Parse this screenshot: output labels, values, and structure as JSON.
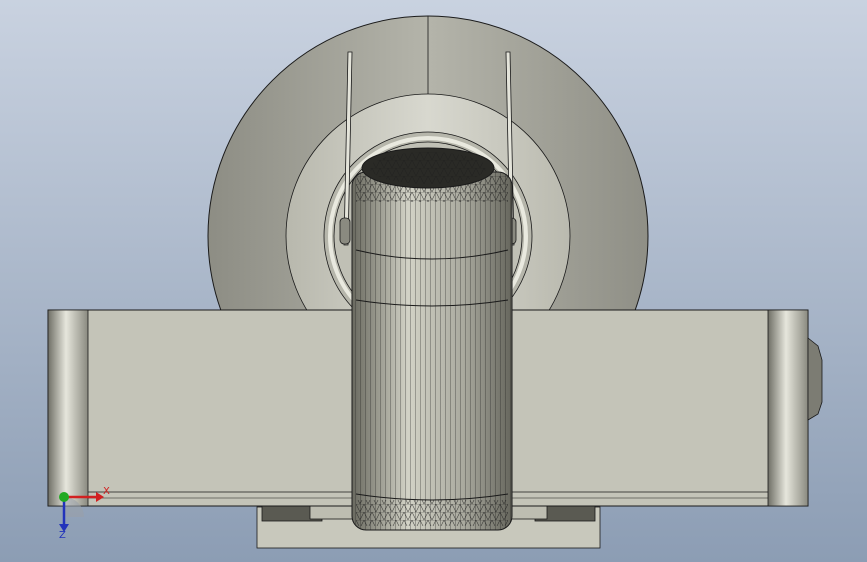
{
  "viewport": {
    "background_top": "#c9d2e0",
    "background_bottom": "#8c9db4"
  },
  "model": {
    "body_color": "#c4c4b8",
    "disc_color": "#a9a99f",
    "cylinder_color": "#b9b9ad",
    "outline_color": "#1a1a1a"
  },
  "triad": {
    "x_label": "X",
    "z_label": "Z",
    "x_color": "#d22020",
    "y_color": "#22aa22",
    "z_color": "#2233bb"
  }
}
